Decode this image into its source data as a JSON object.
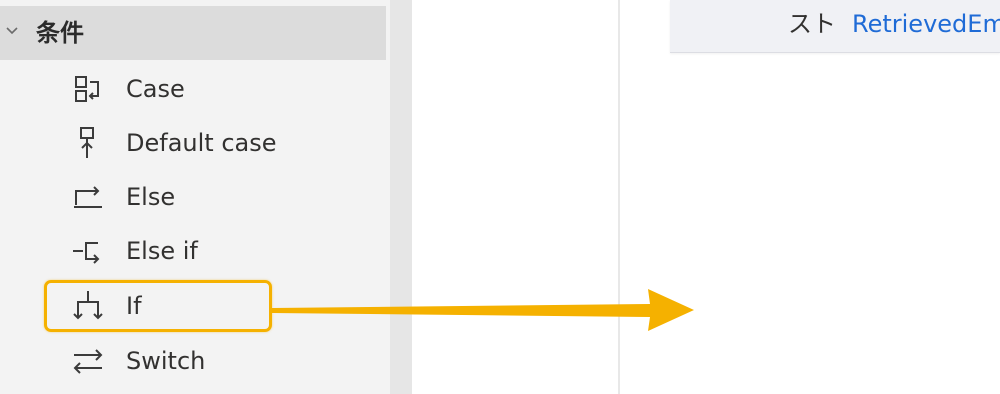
{
  "actions_panel": {
    "group": {
      "title": "条件",
      "chevron_icon": "chevron-down-icon"
    },
    "items": [
      {
        "label": "Case",
        "icon": "case-icon"
      },
      {
        "label": "Default case",
        "icon": "default-case-icon"
      },
      {
        "label": "Else",
        "icon": "else-icon"
      },
      {
        "label": "Else if",
        "icon": "else-if-icon"
      },
      {
        "label": "If",
        "icon": "if-icon"
      },
      {
        "label": "Switch",
        "icon": "switch-icon"
      }
    ],
    "highlighted_item": "If"
  },
  "canvas": {
    "variable_card": {
      "label_suffix": "スト",
      "variable_name": "RetrievedEm"
    }
  },
  "colors": {
    "highlight": "#f5b100",
    "arrow": "#f5b100",
    "variable_blue": "#1f6bd6",
    "panel_bg": "#f3f3f3",
    "group_header_bg": "#dcdcdc"
  }
}
